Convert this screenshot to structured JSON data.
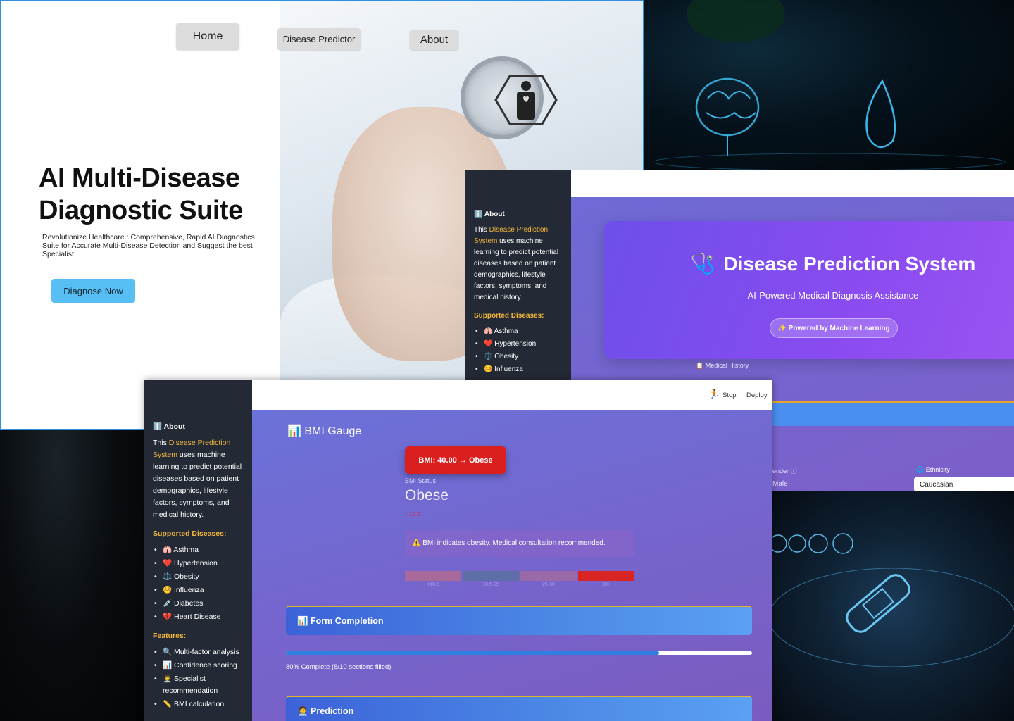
{
  "landing": {
    "nav": {
      "home": "Home",
      "predictor": "Disease Predictor",
      "about": "About"
    },
    "title_line1": "AI Multi-Disease",
    "title_line2": "Diagnostic Suite",
    "subtitle": "Revolutionize Healthcare : Comprehensive, Rapid AI Diagnostics Suite for Accurate Multi-Disease Detection and Suggest the best Specialist.",
    "cta": "Diagnose Now"
  },
  "dps": {
    "sidebar": {
      "about_heading": "ℹ️ About",
      "intro_prefix": "This ",
      "intro_highlight": "Disease Prediction System",
      "intro_suffix": " uses machine learning to predict potential diseases based on patient demographics, lifestyle factors, symptoms, and medical history.",
      "supported_heading": "Supported Diseases:",
      "diseases": [
        "🫁 Asthma",
        "❤️ Hypertension",
        "⚖️ Obesity",
        "🤒 Influenza"
      ]
    },
    "title": "Disease Prediction System",
    "title_icon": "🩺",
    "subtitle": "AI-Powered Medical Diagnosis Assistance",
    "pill": "✨ Powered by Machine Learning",
    "tab_label": "📋 Medical History",
    "gender_label": "ender ⓘ",
    "gender_value": "Male",
    "ethnicity_label": "🌐 Ethnicity",
    "ethnicity_value": "Caucasian"
  },
  "bmi": {
    "topbar": {
      "stop": "Stop",
      "deploy": "Deploy"
    },
    "sidebar": {
      "about_heading": "ℹ️ About",
      "intro_prefix": "This ",
      "intro_highlight": "Disease Prediction System",
      "intro_suffix": " uses machine learning to predict potential diseases based on patient demographics, lifestyle factors, symptoms, and medical history.",
      "supported_heading": "Supported Diseases:",
      "diseases": [
        "🫁 Asthma",
        "❤️ Hypertension",
        "⚖️ Obesity",
        "🤒 Influenza",
        "💉 Diabetes",
        "💔 Heart Disease"
      ],
      "features_heading": "Features:",
      "features": [
        "🔍 Multi-factor analysis",
        "📊 Confidence scoring",
        "👨‍⚕️ Specialist recommendation",
        "📏 BMI calculation"
      ]
    },
    "section_title": "📊 BMI Gauge",
    "badge": "BMI: 40.00 → Obese",
    "status_label": "BMI Status",
    "status_value": "Obese",
    "delta": "↑ 10.0",
    "warning": "⚠️ BMI indicates obesity. Medical consultation recommended.",
    "scale_labels": [
      "<18.5",
      "18.5-25",
      "25-30",
      "30+"
    ],
    "scale_colors": [
      "#a86a9a",
      "#5e6fa8",
      "#9a6aa8",
      "#d92424"
    ],
    "form_panel": "📊 Form Completion",
    "progress_fraction": 0.8,
    "progress_text": "80% Complete (8/10 sections filled)",
    "prediction_panel": "🧑‍⚕️ Prediction"
  }
}
